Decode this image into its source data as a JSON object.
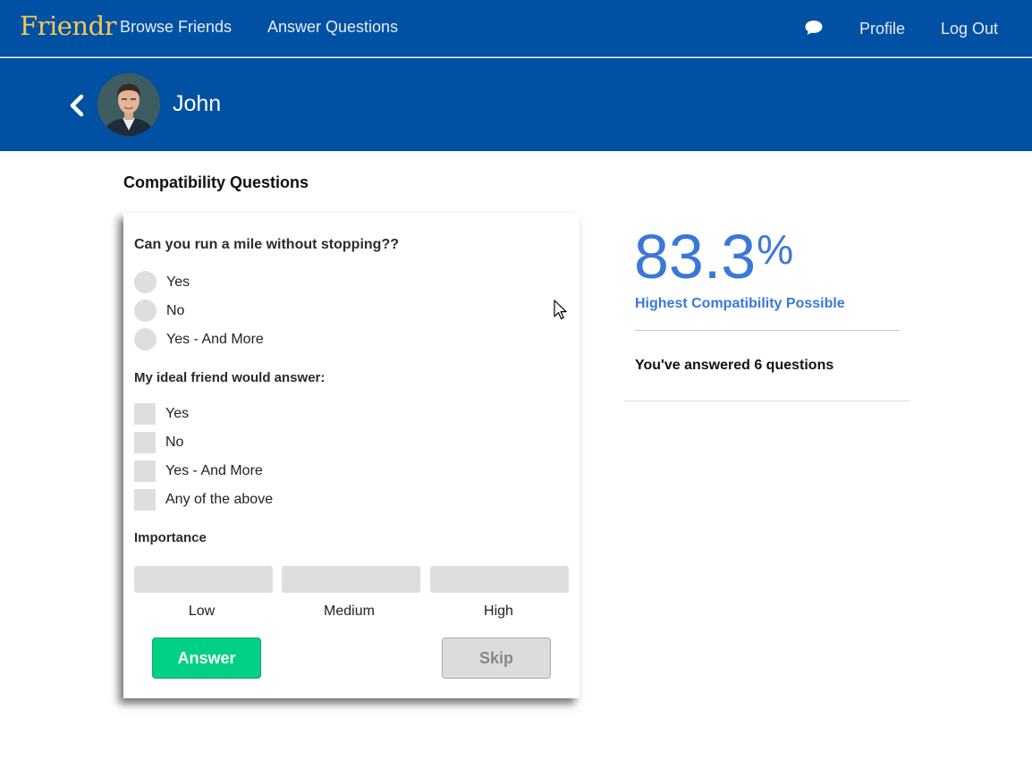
{
  "nav": {
    "brand": "Friendr",
    "links": [
      "Browse Friends",
      "Answer Questions"
    ],
    "profile": "Profile",
    "logout": "Log Out",
    "chat_icon": "chat-bubble-icon"
  },
  "header": {
    "name": "John",
    "back_icon": "chevron-left-icon"
  },
  "section_title": "Compatibility Questions",
  "question": {
    "text": "Can you run a mile without stopping??",
    "options": [
      "Yes",
      "No",
      "Yes - And More"
    ],
    "ideal_heading": "My ideal friend would answer:",
    "ideal_options": [
      "Yes",
      "No",
      "Yes - And More",
      "Any of the above"
    ],
    "importance_heading": "Importance",
    "importance_levels": [
      "Low",
      "Medium",
      "High"
    ],
    "answer_label": "Answer",
    "skip_label": "Skip"
  },
  "compatibility": {
    "value": "83.3",
    "percent_sign": "%",
    "caption": "Highest Compatibility Possible",
    "answered_text": "You've answered 6 questions"
  },
  "colors": {
    "nav_bg": "#0050a3",
    "brand": "#f0c95a",
    "accent": "#3a78d8",
    "answer_button": "#00d084"
  }
}
